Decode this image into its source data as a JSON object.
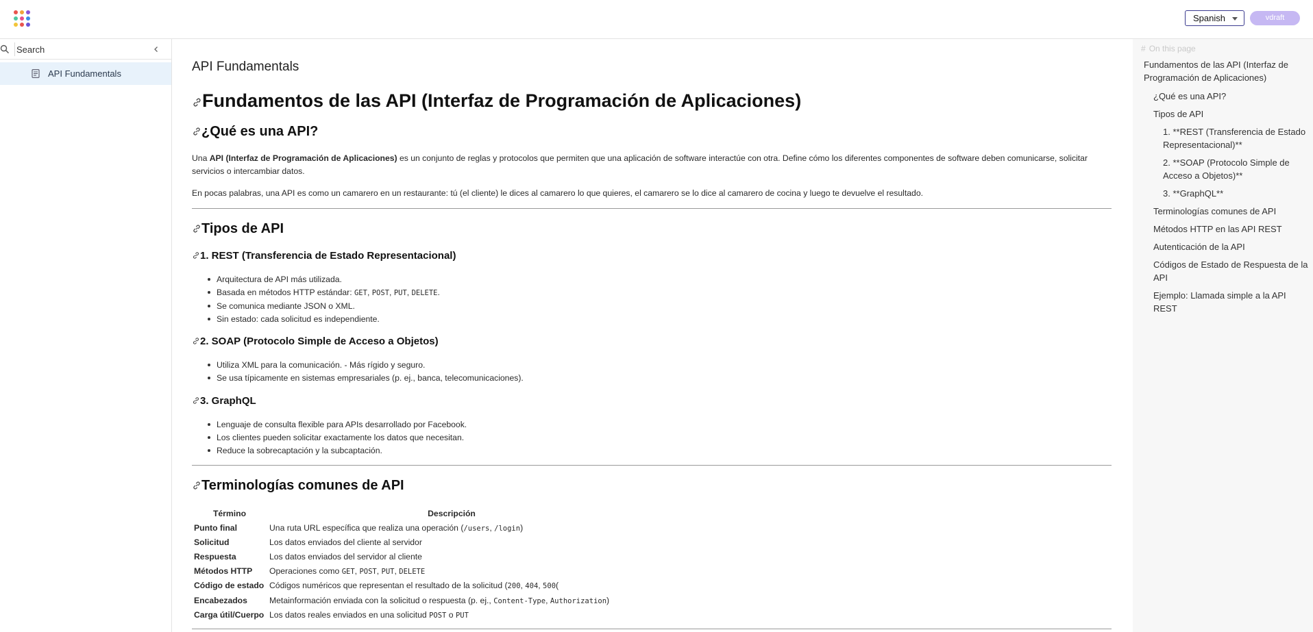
{
  "header": {
    "language": "Spanish",
    "user": "vdraft",
    "logo_colors": [
      "#e8544e",
      "#f2a33a",
      "#8c54d8",
      "#4ec7a0",
      "#e84e8b",
      "#3b8ee8",
      "#f2c53a",
      "#e8544e",
      "#6b54d8"
    ]
  },
  "sidebar": {
    "search_placeholder": "Search",
    "items": [
      {
        "label": "API Fundamentals"
      }
    ]
  },
  "doc": {
    "page_title": "API Fundamentals",
    "h1": "Fundamentos de las API (Interfaz de Programación de Aplicaciones)",
    "sec1": {
      "title": "¿Qué es una API?",
      "p1_prefix": "Una ",
      "p1_bold": "API (Interfaz de Programación de Aplicaciones)",
      "p1_rest": " es un conjunto de reglas y protocolos que permiten que una aplicación de software interactúe con otra. Define cómo los diferentes componentes de software deben comunicarse, solicitar servicios o intercambiar datos.",
      "p2": "En pocas palabras, una API es como un camarero en un restaurante: tú (el cliente) le dices al camarero lo que quieres, el camarero se lo dice al camarero de cocina y luego te devuelve el resultado."
    },
    "sec2": {
      "title": "Tipos de API",
      "rest": {
        "title": "1. REST (Transferencia de Estado Representacional)",
        "b1": "Arquitectura de API más utilizada.",
        "b2_prefix": "Basada en métodos HTTP estándar: ",
        "b2_codes": [
          "GET",
          "POST",
          "PUT",
          "DELETE"
        ],
        "b2_suffix": ".",
        "b3": "Se comunica mediante JSON o XML.",
        "b4": "Sin estado: cada solicitud es independiente."
      },
      "soap": {
        "title": "2. SOAP (Protocolo Simple de Acceso a Objetos)",
        "b1": "Utiliza XML para la comunicación. - Más rígido y seguro.",
        "b2": "Se usa típicamente en sistemas empresariales (p. ej., banca, telecomunicaciones)."
      },
      "graphql": {
        "title": "3. GraphQL",
        "b1": "Lenguaje de consulta flexible para APIs desarrollado por Facebook.",
        "b2": "Los clientes pueden solicitar exactamente los datos que necesitan.",
        "b3": "Reduce la sobrecaptación y la subcaptación."
      }
    },
    "sec3": {
      "title": "Terminologías comunes de API",
      "col_term": "Término",
      "col_desc": "Descripción",
      "rows": [
        {
          "term": "Punto final",
          "desc": "Una ruta URL específica que realiza una operación (",
          "codes": [
            "/users",
            "/login"
          ],
          "tail": ")"
        },
        {
          "term": "Solicitud",
          "desc": "Los datos enviados del cliente al servidor"
        },
        {
          "term": "Respuesta",
          "desc": "Los datos enviados del servidor al cliente"
        },
        {
          "term": "Métodos HTTP",
          "desc": "Operaciones como ",
          "codes": [
            "GET",
            "POST",
            "PUT",
            "DELETE"
          ],
          "tail": ""
        },
        {
          "term": "Código de estado",
          "desc": "Códigos numéricos que representan el resultado de la solicitud (",
          "codes": [
            "200",
            "404",
            "500"
          ],
          "tail": "("
        },
        {
          "term": "Encabezados",
          "desc": "Metainformación enviada con la solicitud o respuesta (p. ej., ",
          "codes": [
            "Content-Type",
            "Authorization"
          ],
          "tail": ")"
        },
        {
          "term": "Carga útil/Cuerpo",
          "desc": "Los datos reales enviados en una solicitud ",
          "codes": [
            "POST",
            "PUT"
          ],
          "joiner": " o ",
          "tail": ""
        }
      ]
    }
  },
  "toc": {
    "title": "On this page",
    "items": [
      {
        "label": "Fundamentos de las API (Interfaz de Programación de Aplicaciones)"
      },
      {
        "label": "¿Qué es una API?"
      },
      {
        "label": "Tipos de API"
      },
      {
        "label": "1. **REST (Transferencia de Estado Representacional)**"
      },
      {
        "label": "2. **SOAP (Protocolo Simple de Acceso a Objetos)**"
      },
      {
        "label": "3. **GraphQL**"
      },
      {
        "label": "Terminologías comunes de API"
      },
      {
        "label": "Métodos HTTP en las API REST"
      },
      {
        "label": "Autenticación de la API"
      },
      {
        "label": "Códigos de Estado de Respuesta de la API"
      },
      {
        "label": "Ejemplo: Llamada simple a la API REST"
      }
    ]
  }
}
